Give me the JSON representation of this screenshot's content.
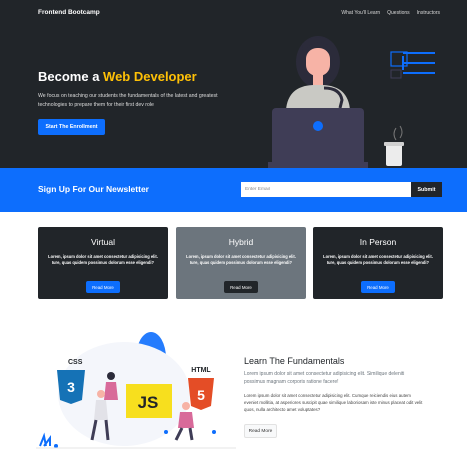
{
  "nav": {
    "brand": "Frontend Bootcamp",
    "links": [
      "What You'll Learn",
      "Questions",
      "Instructors"
    ]
  },
  "hero": {
    "title_prefix": "Become a",
    "title_highlight": "Web Developer",
    "description": "We focus on teaching our students the fundamentals of the latest and greatest technologies to prepare them for their first dev role",
    "cta_label": "Start The Enrollment"
  },
  "newsletter": {
    "title": "Sign Up For Our Newsletter",
    "email_placeholder": "Enter Email",
    "submit_label": "Submit"
  },
  "cards": [
    {
      "title": "Virtual",
      "text": "Lorem, ipsum dolor sit amet consectetur adipisicing elit. Iure, quas quidem possimus dolorum esse eligendi?",
      "button": "Read More"
    },
    {
      "title": "Hybrid",
      "text": "Lorem, ipsum dolor sit amet consectetur adipisicing elit. Iure, quas quidem possimus dolorum esse eligendi?",
      "button": "Read More"
    },
    {
      "title": "In Person",
      "text": "Lorem, ipsum dolor sit amet consectetur adipisicing elit. Iure, quas quidem possimus dolorum esse eligendi?",
      "button": "Read More"
    }
  ],
  "fundamentals": {
    "title": "Learn The Fundamentals",
    "lead": "Lorem ipsum dolor sit amet consectetur adipisicing elit. Similique deleniti possimus magnam corporis ratione facere!",
    "text": "Lorem ipsum dolor sit amet consectetur adipisicing elit. Cumque reiciendis eius autem eveniet mollitia, at asperiores suscipit quae similique laboriosam iste minus placeat odit velit quos, nulla architecto amet voluptates?",
    "button": "Read More",
    "art_labels": {
      "css": "CSS",
      "js": "JS",
      "html": "HTML"
    }
  },
  "colors": {
    "dark": "#212529",
    "primary": "#0d6efd",
    "warning": "#ffc107",
    "secondary": "#6c757d"
  }
}
